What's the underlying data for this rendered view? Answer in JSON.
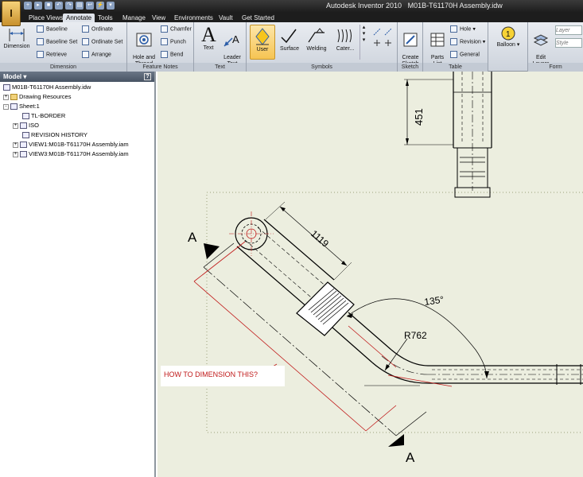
{
  "app": {
    "title": "Autodesk Inventor 2010",
    "document": "M01B-T61170H Assembly.idw",
    "logo_letter": "I"
  },
  "tabs": [
    "Place Views",
    "Annotate",
    "Tools",
    "Manage",
    "View",
    "Environments",
    "Vault",
    "Get Started"
  ],
  "active_tab": "Annotate",
  "ribbon": {
    "dimension": {
      "label": "Dimension",
      "big": "Dimension",
      "items": [
        "Baseline",
        "Baseline Set",
        "Retrieve",
        "Ordinate",
        "Ordinate Set",
        "Arrange"
      ]
    },
    "feature_notes": {
      "label": "Feature Notes",
      "hole": "Hole and\nThread",
      "items": [
        "Chamfer",
        "Punch",
        "Bend"
      ]
    },
    "text": {
      "label": "Text",
      "text": "Text",
      "leader": "Leader\nText"
    },
    "symbols": {
      "label": "Symbols",
      "items": [
        "User",
        "Surface",
        "Welding",
        "Cater..."
      ]
    },
    "sketch": {
      "label": "Sketch",
      "create": "Create\nSketch"
    },
    "table": {
      "label": "Table",
      "parts_list": "Parts\nList",
      "items": [
        "Hole",
        "Revision",
        "General"
      ]
    },
    "balloon": {
      "label": "Balloon",
      "icon_text": "1"
    },
    "format": {
      "label": "Form",
      "edit_layers": "Edit\nLayers",
      "layer_placeholder": "Layer",
      "style_placeholder": "Style"
    }
  },
  "browser": {
    "title": "Model",
    "help": "?",
    "tree": [
      {
        "label": "M01B-T61170H Assembly.idw",
        "level": 0,
        "expander": ""
      },
      {
        "label": "Drawing Resources",
        "level": 1,
        "expander": "+"
      },
      {
        "label": "Sheet:1",
        "level": 1,
        "expander": "-"
      },
      {
        "label": "TL-BORDER",
        "level": 2,
        "expander": ""
      },
      {
        "label": "ISO",
        "level": 2,
        "expander": "+"
      },
      {
        "label": "REVISION HISTORY",
        "level": 2,
        "expander": ""
      },
      {
        "label": "VIEW1:M01B-T61170H Assembly.iam",
        "level": 2,
        "expander": "+"
      },
      {
        "label": "VIEW3:M01B-T61170H Assembly.iam",
        "level": 2,
        "expander": "+"
      }
    ]
  },
  "drawing": {
    "dim_vertical": "451",
    "dim_length": "1119",
    "dim_angle": "135°",
    "dim_radius": "R762",
    "section_label_top": "A",
    "section_label_bottom": "A",
    "note": "HOW TO DIMENSION THIS?",
    "colors": {
      "background": "#eceedf",
      "geometry": "#000000",
      "note_line": "#c01818"
    }
  }
}
